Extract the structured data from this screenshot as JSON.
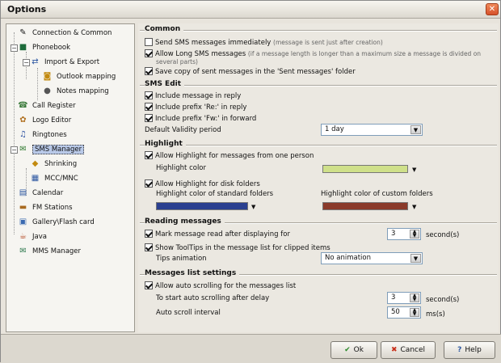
{
  "window": {
    "title": "Options",
    "close_glyph": "✕"
  },
  "tree": {
    "items": [
      {
        "label": "Connection & Common",
        "icon": "connection-icon"
      },
      {
        "label": "Phonebook",
        "icon": "phonebook-icon"
      },
      {
        "label": "Import & Export",
        "icon": "import-export-icon"
      },
      {
        "label": "Outlook mapping",
        "icon": "outlook-icon"
      },
      {
        "label": "Notes mapping",
        "icon": "notes-icon"
      },
      {
        "label": "Call Register",
        "icon": "call-register-icon"
      },
      {
        "label": "Logo Editor",
        "icon": "logo-editor-icon"
      },
      {
        "label": "Ringtones",
        "icon": "ringtones-icon"
      },
      {
        "label": "SMS Manager",
        "icon": "sms-manager-icon",
        "selected": true
      },
      {
        "label": "Shrinking",
        "icon": "shrinking-icon"
      },
      {
        "label": "MCC/MNC",
        "icon": "mcc-mnc-icon"
      },
      {
        "label": "Calendar",
        "icon": "calendar-icon"
      },
      {
        "label": "FM Stations",
        "icon": "fm-stations-icon"
      },
      {
        "label": "Gallery\\Flash card",
        "icon": "gallery-icon"
      },
      {
        "label": "Java",
        "icon": "java-icon"
      },
      {
        "label": "MMS Manager",
        "icon": "mms-manager-icon"
      }
    ]
  },
  "common": {
    "title": "Common",
    "send_immediately": {
      "label": "Send SMS messages immediately",
      "note": "(message is sent just after creation)",
      "checked": false
    },
    "allow_long": {
      "label": "Allow Long SMS messages",
      "note": "(if a message length is longer than a maximum size a message is divided on",
      "note2": "several parts)",
      "checked": true
    },
    "save_copy": {
      "label": "Save copy of sent messages in the 'Sent messages' folder",
      "checked": true
    }
  },
  "sms_edit": {
    "title": "SMS Edit",
    "include_in_reply": {
      "label": "Include message in reply",
      "checked": true
    },
    "prefix_re": {
      "label": "Include prefix 'Re:' in reply",
      "checked": true
    },
    "prefix_fw": {
      "label": "Include prefix 'Fw:' in forward",
      "checked": true
    },
    "validity_label": "Default Validity period",
    "validity_value": "1 day"
  },
  "highlight": {
    "title": "Highlight",
    "one_person": {
      "label": "Allow Highlight for messages from one person",
      "checked": true
    },
    "color_label": "Highlight color",
    "color": "#cfe08a",
    "disk_folders": {
      "label": "Allow Highlight for disk folders",
      "checked": true
    },
    "standard_label": "Highlight color of standard folders",
    "standard_color": "#2a3f8f",
    "custom_label": "Highlight color of custom folders",
    "custom_color": "#8a3a2a"
  },
  "reading": {
    "title": "Reading messages",
    "mark_read": {
      "label": "Mark message read after displaying for",
      "checked": true
    },
    "mark_value": "3",
    "mark_unit": "second(s)",
    "show_tooltips": {
      "label": "Show ToolTips in the message list for clipped items",
      "checked": true
    },
    "tips_label": "Tips animation",
    "tips_value": "No animation"
  },
  "list_settings": {
    "title": "Messages list settings",
    "auto_scroll": {
      "label": "Allow auto scrolling for the messages list",
      "checked": true
    },
    "delay_label": "To start auto scrolling after delay",
    "delay_value": "3",
    "delay_unit": "second(s)",
    "interval_label": "Auto scroll interval",
    "interval_value": "50",
    "interval_unit": "ms(s)"
  },
  "buttons": {
    "ok": "Ok",
    "cancel": "Cancel",
    "help": "Help"
  }
}
